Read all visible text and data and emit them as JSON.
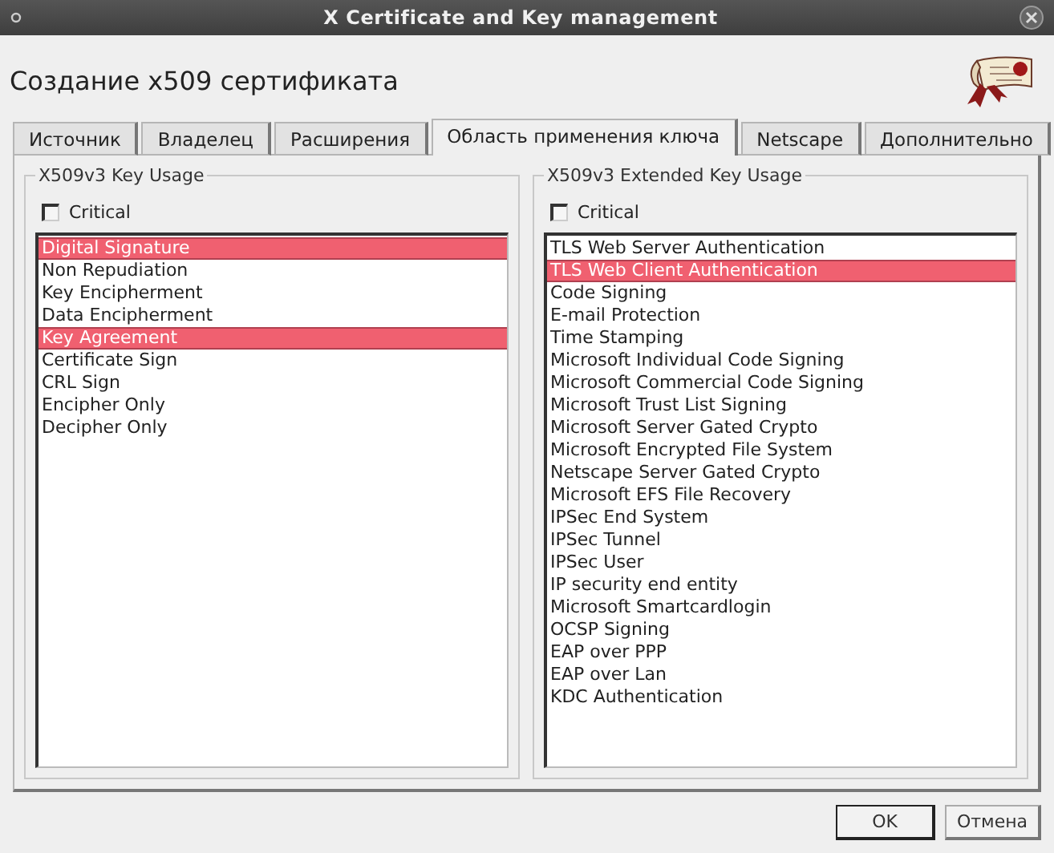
{
  "window": {
    "title": "X Certificate and Key management"
  },
  "heading": "Создание x509 сертификата",
  "tabs": [
    {
      "label": "Источник",
      "selected": false
    },
    {
      "label": "Владелец",
      "selected": false
    },
    {
      "label": "Расширения",
      "selected": false
    },
    {
      "label": "Область применения ключа",
      "selected": true
    },
    {
      "label": "Netscape",
      "selected": false
    },
    {
      "label": "Дополнительно",
      "selected": false
    }
  ],
  "key_usage": {
    "title": "X509v3 Key Usage",
    "critical": {
      "label": "Critical",
      "checked": false
    },
    "items": [
      {
        "label": "Digital Signature",
        "selected": true
      },
      {
        "label": "Non Repudiation",
        "selected": false
      },
      {
        "label": "Key Encipherment",
        "selected": false
      },
      {
        "label": "Data Encipherment",
        "selected": false
      },
      {
        "label": "Key Agreement",
        "selected": true
      },
      {
        "label": "Certificate Sign",
        "selected": false
      },
      {
        "label": "CRL Sign",
        "selected": false
      },
      {
        "label": "Encipher Only",
        "selected": false
      },
      {
        "label": "Decipher Only",
        "selected": false
      }
    ]
  },
  "extended_key_usage": {
    "title": "X509v3 Extended Key Usage",
    "critical": {
      "label": "Critical",
      "checked": false
    },
    "items": [
      {
        "label": "TLS Web Server Authentication",
        "selected": false
      },
      {
        "label": "TLS Web Client Authentication",
        "selected": true
      },
      {
        "label": "Code Signing",
        "selected": false
      },
      {
        "label": "E-mail Protection",
        "selected": false
      },
      {
        "label": "Time Stamping",
        "selected": false
      },
      {
        "label": "Microsoft Individual Code Signing",
        "selected": false
      },
      {
        "label": "Microsoft Commercial Code Signing",
        "selected": false
      },
      {
        "label": "Microsoft Trust List Signing",
        "selected": false
      },
      {
        "label": "Microsoft Server Gated Crypto",
        "selected": false
      },
      {
        "label": "Microsoft Encrypted File System",
        "selected": false
      },
      {
        "label": "Netscape Server Gated Crypto",
        "selected": false
      },
      {
        "label": "Microsoft EFS File Recovery",
        "selected": false
      },
      {
        "label": "IPSec End System",
        "selected": false
      },
      {
        "label": "IPSec Tunnel",
        "selected": false
      },
      {
        "label": "IPSec User",
        "selected": false
      },
      {
        "label": "IP security end entity",
        "selected": false
      },
      {
        "label": "Microsoft Smartcardlogin",
        "selected": false
      },
      {
        "label": "OCSP Signing",
        "selected": false
      },
      {
        "label": "EAP over PPP",
        "selected": false
      },
      {
        "label": "EAP over Lan",
        "selected": false
      },
      {
        "label": "KDC Authentication",
        "selected": false
      }
    ]
  },
  "buttons": [
    {
      "label": "OK",
      "default": true
    },
    {
      "label": "Отмена",
      "default": false
    }
  ]
}
